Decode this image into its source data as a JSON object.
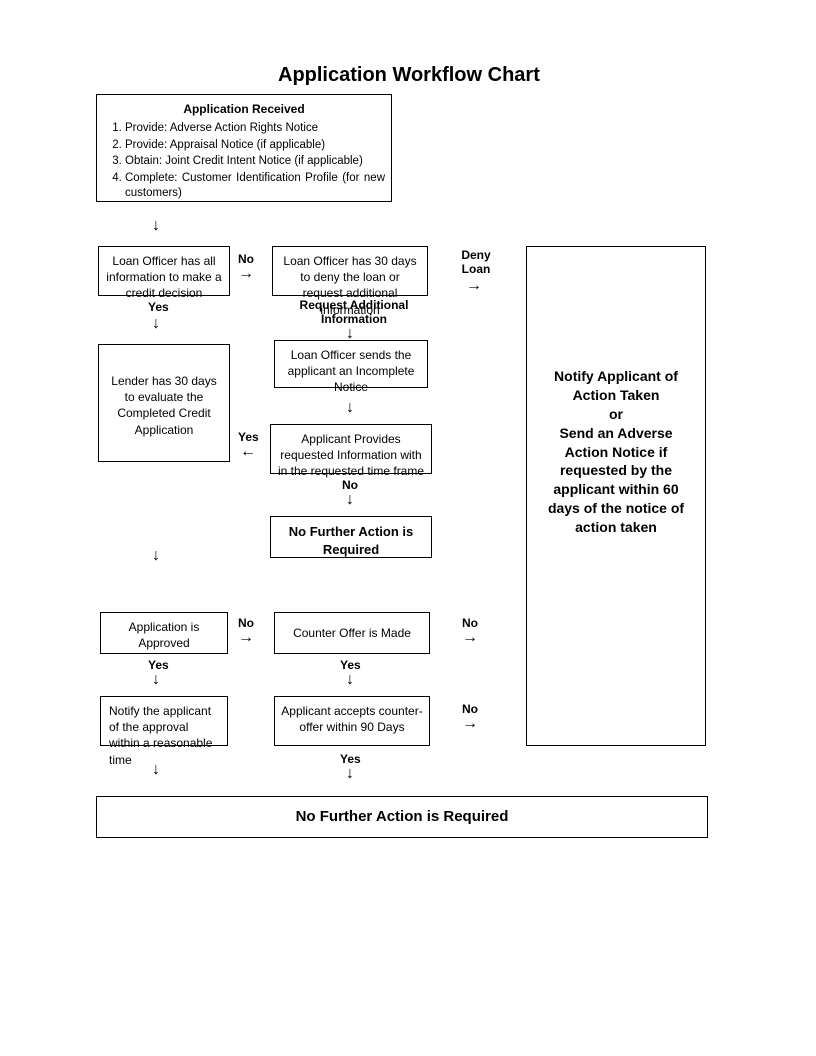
{
  "title": "Application Workflow Chart",
  "app_received": {
    "heading": "Application Received",
    "items": [
      "Provide: Adverse Action Rights Notice",
      "Provide: Appraisal Notice (if applicable)",
      "Obtain: Joint Credit Intent Notice (if applicable)",
      "Complete: Customer Identification Profile (for new customers)"
    ]
  },
  "boxes": {
    "loan_officer_info": "Loan Officer has all information to make a credit decision",
    "loan_officer_30": "Loan Officer has 30 days to deny the loan or request additional information",
    "request_additional": "Request Additional Information",
    "incomplete_notice": "Loan Officer sends the applicant an Incomplete Notice",
    "lender_30": "Lender has 30 days to evaluate the Completed Credit Application",
    "applicant_provides": "Applicant Provides requested Information with in the requested time frame",
    "no_action_mid": "No Further Action is Required",
    "app_approved": "Application is Approved",
    "counter_offer": "Counter Offer is Made",
    "notify_approval": "Notify the applicant of the approval within a reasonable time",
    "applicant_accepts": "Applicant accepts counter-offer within 90 Days",
    "no_action_final": "No Further Action is Required",
    "notify_action": "Notify Applicant of Action Taken\nor\nSend an Adverse Action Notice if requested by the applicant within 60 days of the notice of action taken"
  },
  "labels": {
    "yes": "Yes",
    "no": "No",
    "deny_loan": "Deny Loan"
  }
}
